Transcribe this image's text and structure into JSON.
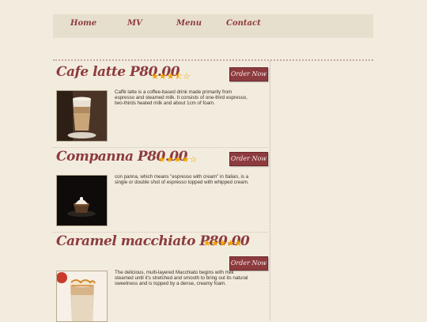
{
  "nav": {
    "items": [
      "Home",
      "MV",
      "Menu",
      "Contact"
    ]
  },
  "products": [
    {
      "title": "Cafe latte P80.00",
      "rating_stars": "★★★⯪☆",
      "rating": 3.5,
      "order_label": "Order Now",
      "description": "Caffè latte is a coffee-based drink made primarily from espresso and steamed milk. It consists of one-third espresso, two-thirds heated milk and about 1cm of foam."
    },
    {
      "title": "Companna P80.00",
      "rating_stars": "★★★★☆",
      "rating": 4,
      "order_label": "Order Now",
      "description": "con panna, which means \"espresso with cream\" in Italian, is a single or double shot of espresso topped with whipped cream."
    },
    {
      "title": "Caramel macchiato P80.00",
      "rating_stars": "★★★★★",
      "rating": 5,
      "order_label": "Order Now",
      "description": "The delicious, multi-layered Macchiato begins with milk steamed until it's stretched and smooth to bring out its natural sweetness and is topped by a dense, creamy foam."
    }
  ],
  "colors": {
    "background": "#f2ecdf",
    "nav_bg": "#e7dfcd",
    "accent": "#8d3b3e",
    "star": "#f0a300"
  }
}
